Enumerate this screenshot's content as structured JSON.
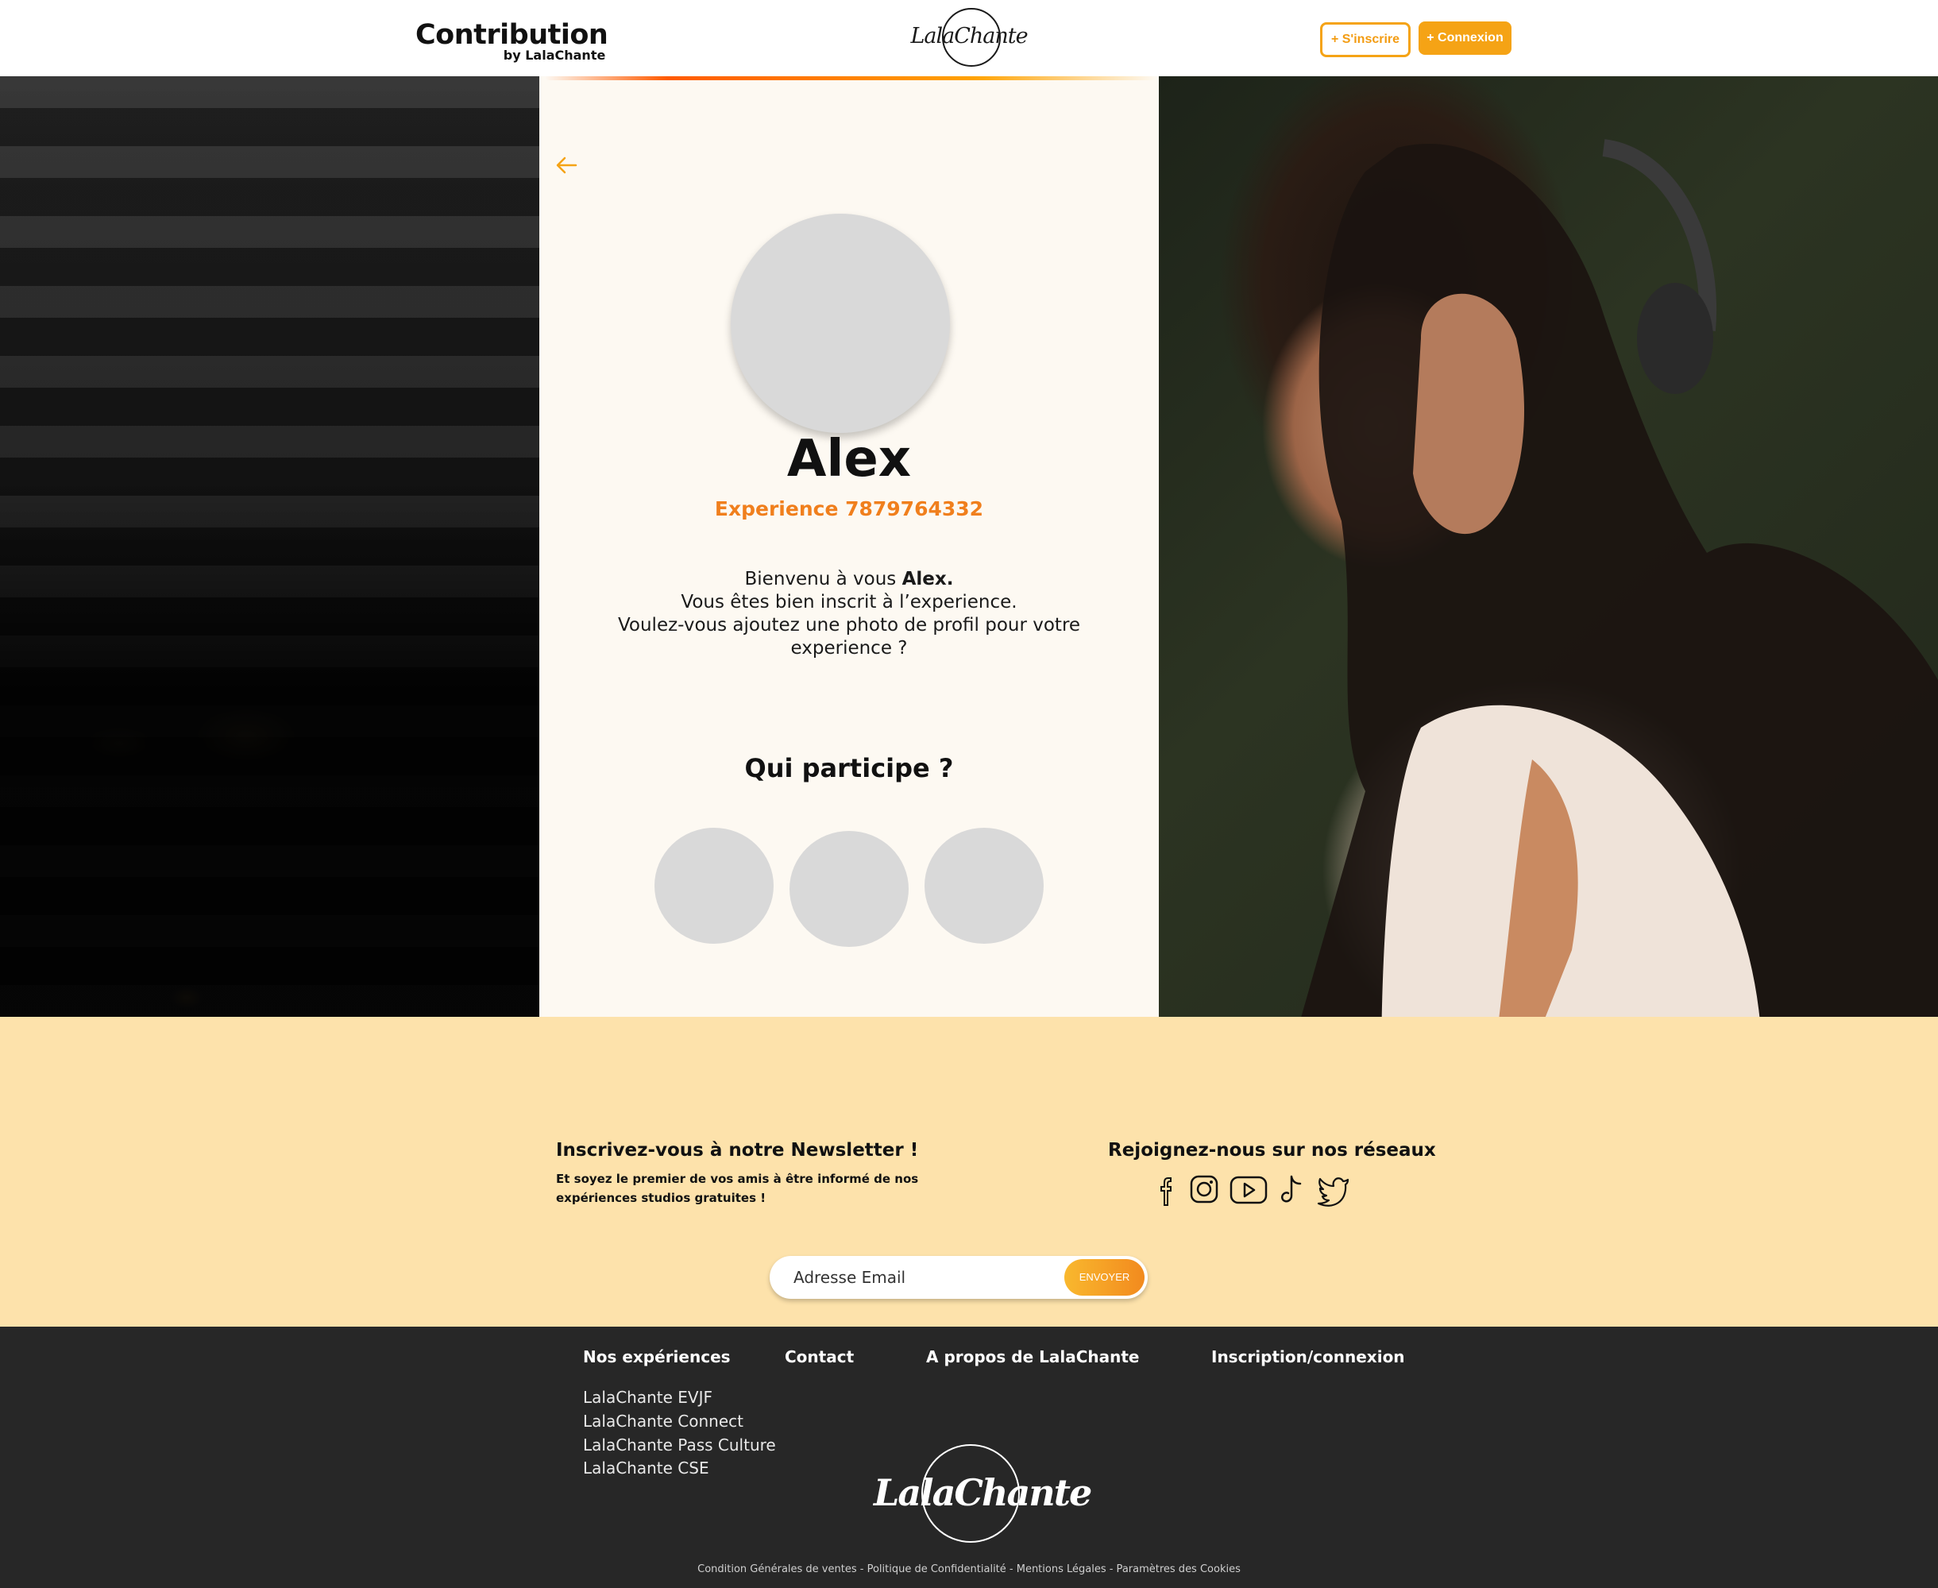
{
  "header": {
    "brand_title": "Contribution",
    "brand_sub": "by LalaChante",
    "logo_text": "LalaChante",
    "signup_label": "+ S'inscrire",
    "login_label": "+ Connexion"
  },
  "profile": {
    "name": "Alex",
    "experience": "Experience 7879764332",
    "welcome_prefix": "Bienvenu à vous ",
    "welcome_name": "Alex.",
    "welcome_line2": "Vous êtes bien inscrit à l’experience.",
    "welcome_line3": "Voulez-vous ajoutez une photo de profil pour votre",
    "welcome_line4": "experience ?"
  },
  "participants": {
    "title": "Qui participe ?"
  },
  "newsletter": {
    "title": "Inscrivez-vous à notre Newsletter !",
    "text": "Et soyez le premier de vos amis à être informé de nos expériences studios gratuites !",
    "email_placeholder": "Adresse Email",
    "send_label": "ENVOYER"
  },
  "social": {
    "title": "Rejoignez-nous sur nos réseaux",
    "icons": [
      "facebook-icon",
      "instagram-icon",
      "youtube-icon",
      "tiktok-icon",
      "twitter-icon"
    ]
  },
  "footer": {
    "col1_title": "Nos expériences",
    "col2_title": "Contact",
    "col3_title": "A propos de LalaChante",
    "col4_title": "Inscription/connexion",
    "links": [
      "LalaChante EVJF",
      "LalaChante Connect",
      "LalaChante Pass Culture",
      "LalaChante CSE"
    ],
    "logo_text": "LalaChante",
    "legal": "Condition Générales de ventes - Politique de Confidentialité - Mentions Légales - Paramètres des Cookies"
  },
  "colors": {
    "accent_orange": "#f5a315",
    "experience_orange": "#f07f1d",
    "newsletter_bg": "#fde2ab",
    "footer_bg": "#272727"
  }
}
